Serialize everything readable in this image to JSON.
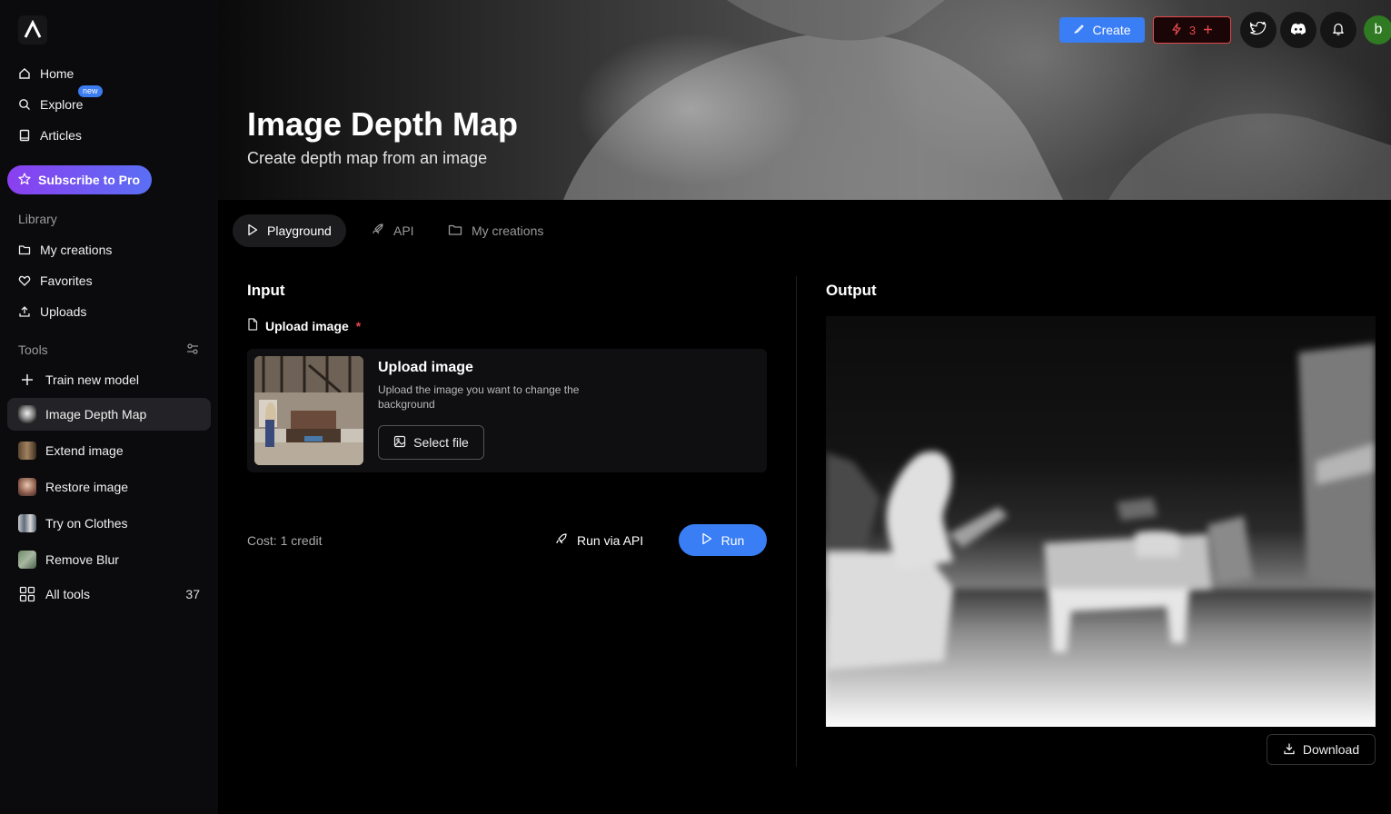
{
  "sidebar": {
    "nav": [
      {
        "label": "Home",
        "icon": "home-icon"
      },
      {
        "label": "Explore",
        "icon": "search-icon",
        "badge": "new"
      },
      {
        "label": "Articles",
        "icon": "book-icon"
      }
    ],
    "pro_label": "Subscribe to Pro",
    "library_label": "Library",
    "library": [
      {
        "label": "My creations",
        "icon": "folder-icon"
      },
      {
        "label": "Favorites",
        "icon": "heart-icon"
      },
      {
        "label": "Uploads",
        "icon": "upload-icon"
      }
    ],
    "tools_label": "Tools",
    "tools": [
      {
        "label": "Train new model",
        "icon": "plus-icon"
      },
      {
        "label": "Image Depth Map",
        "active": true
      },
      {
        "label": "Extend image"
      },
      {
        "label": "Restore image"
      },
      {
        "label": "Try on Clothes"
      },
      {
        "label": "Remove Blur"
      },
      {
        "label": "All tools",
        "icon": "grid-icon",
        "count": "37"
      }
    ]
  },
  "header": {
    "create_label": "Create",
    "credits": "3",
    "avatar_letter": "b"
  },
  "hero": {
    "title": "Image Depth Map",
    "subtitle": "Create depth map from an image"
  },
  "tabs": [
    {
      "label": "Playground",
      "active": true
    },
    {
      "label": "API"
    },
    {
      "label": "My creations"
    }
  ],
  "input": {
    "heading": "Input",
    "field_label": "Upload image",
    "required_mark": "*",
    "card_title": "Upload image",
    "card_desc": "Upload the image you want to change the background",
    "select_label": "Select file",
    "cost": "Cost: 1 credit",
    "run_api_label": "Run via API",
    "run_label": "Run"
  },
  "output": {
    "heading": "Output",
    "download_label": "Download"
  },
  "colors": {
    "accent": "#3a7ef5",
    "danger": "#e5484d",
    "pro_start": "#8b3ff0",
    "pro_end": "#5a6ff5"
  }
}
